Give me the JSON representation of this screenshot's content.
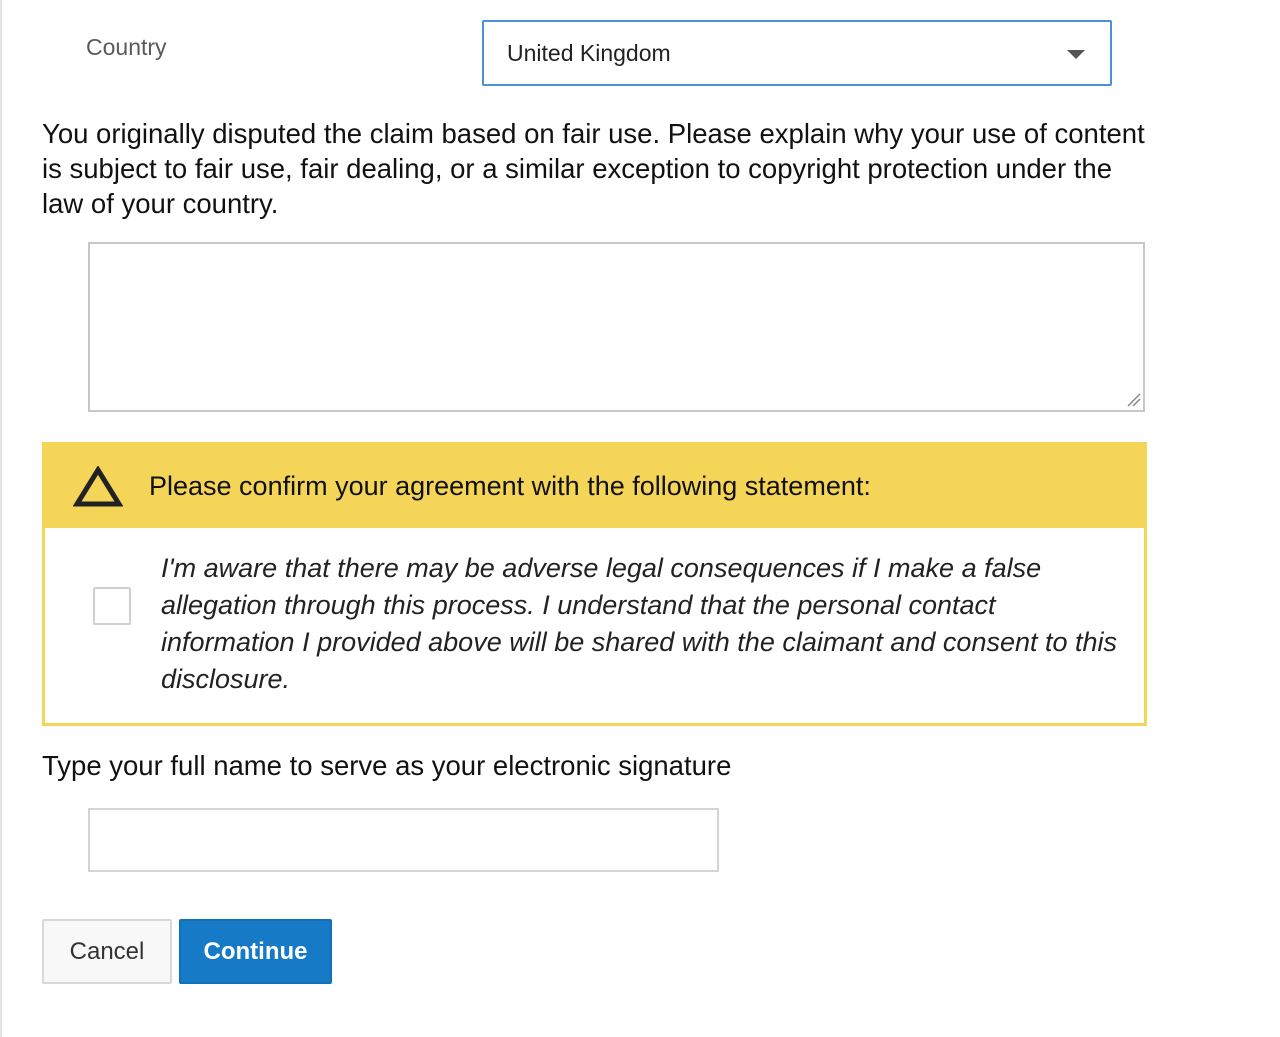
{
  "country": {
    "label": "Country",
    "selected": "United Kingdom"
  },
  "fair_use": {
    "question": "You originally disputed the claim based on fair use. Please explain why your use of content is subject to fair use, fair dealing, or a similar exception to copyright protection under the law of your country.",
    "explanation_value": ""
  },
  "confirmation": {
    "heading": "Please confirm your agreement with the following statement:",
    "statement": "I'm aware that there may be adverse legal consequences if I make a false allegation through this process. I understand that the personal contact information I provided above will be shared with the claimant and consent to this disclosure.",
    "checked": false,
    "icon": "warning-triangle-icon",
    "accent_color": "#f4d558"
  },
  "signature": {
    "label": "Type your full name to serve as your electronic signature",
    "value": ""
  },
  "actions": {
    "cancel_label": "Cancel",
    "continue_label": "Continue",
    "primary_color": "#167ac6"
  }
}
